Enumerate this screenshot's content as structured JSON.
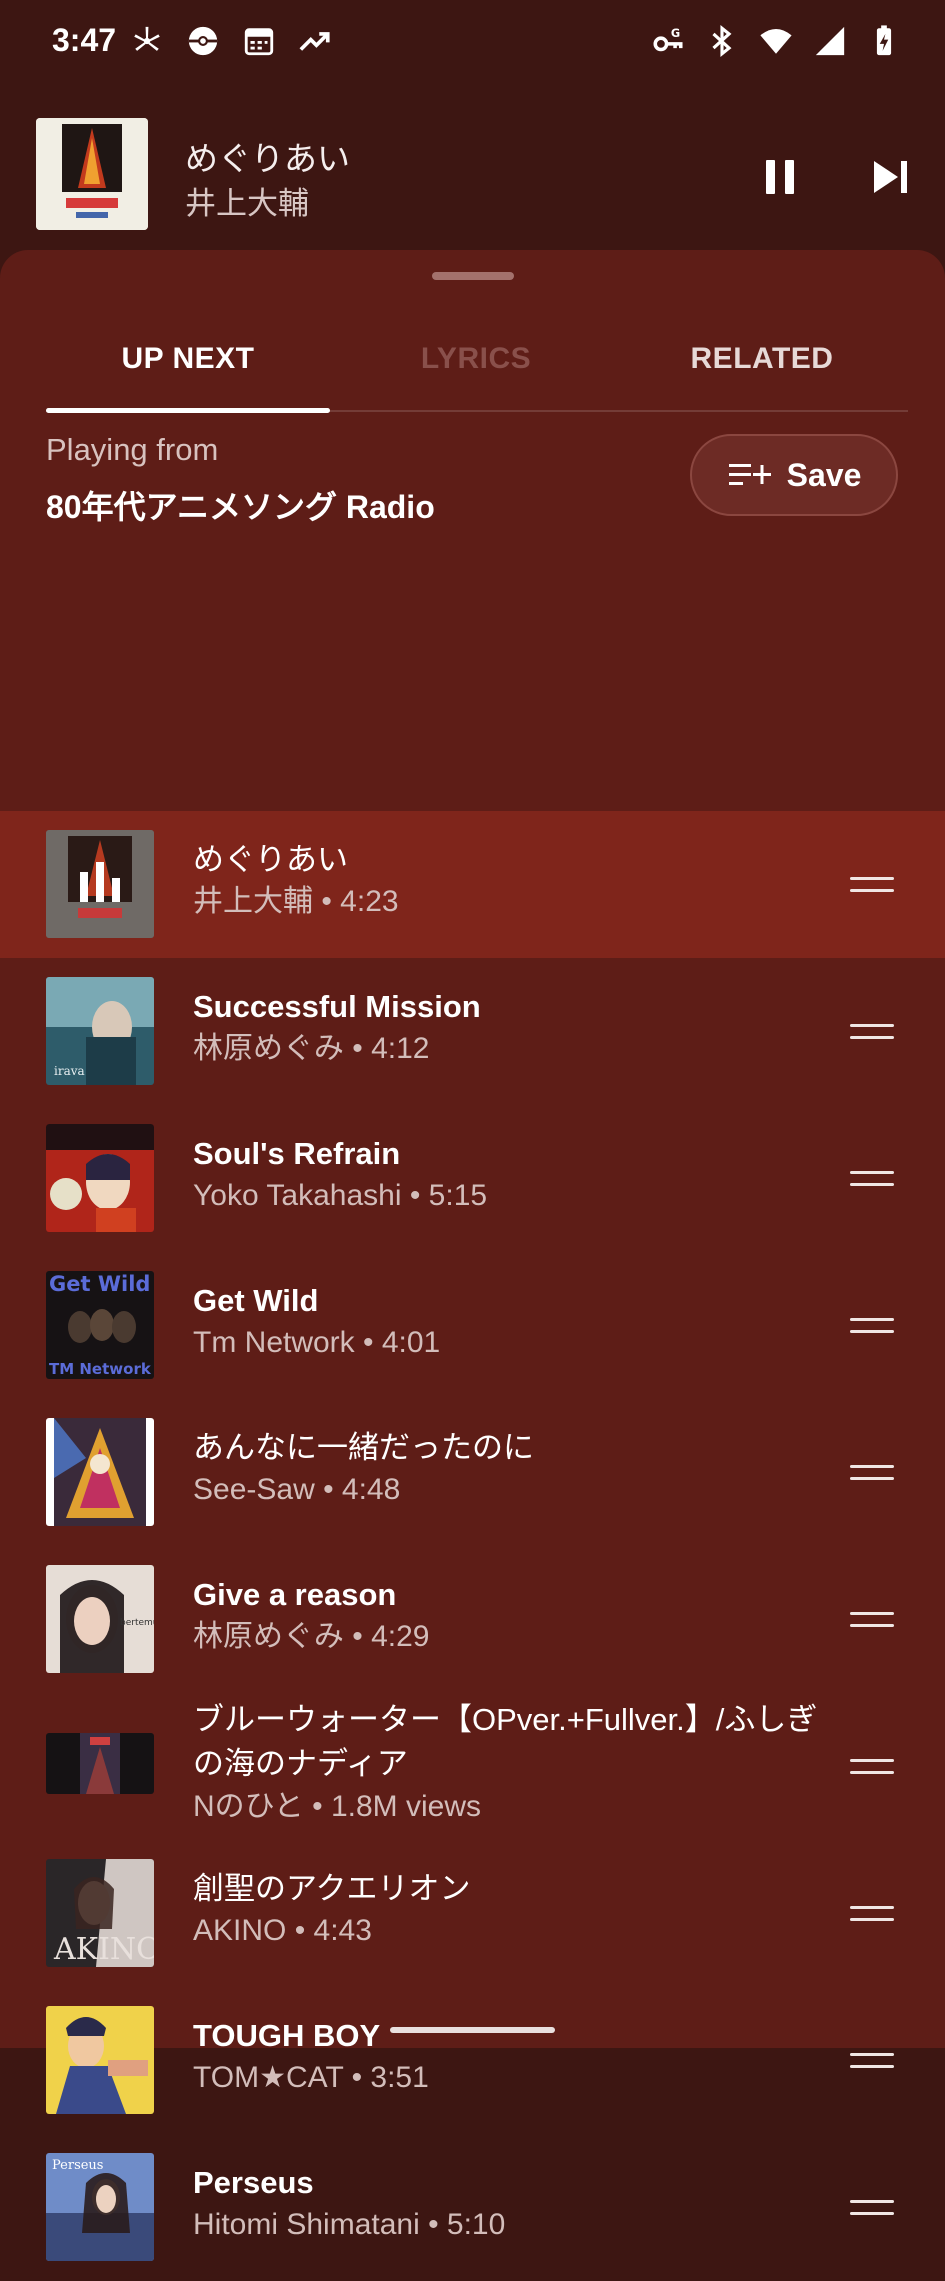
{
  "status": {
    "time": "3:47"
  },
  "mini_player": {
    "title": "めぐりあい",
    "artist": "井上大輔"
  },
  "tabs": [
    {
      "label": "UP NEXT"
    },
    {
      "label": "LYRICS"
    },
    {
      "label": "RELATED"
    }
  ],
  "playing_from": {
    "label": "Playing from",
    "value": "80年代アニメソング Radio"
  },
  "save": {
    "label": "Save"
  },
  "queue": [
    {
      "title": "めぐりあい",
      "subtitle": "井上大輔 • 4:23",
      "active": true
    },
    {
      "title": "Successful Mission",
      "subtitle": "林原めぐみ • 4:12"
    },
    {
      "title": "Soul's Refrain",
      "subtitle": "Yoko Takahashi • 5:15"
    },
    {
      "title": "Get Wild",
      "subtitle": "Tm Network • 4:01",
      "art_text_top": "Get Wild",
      "art_text_bottom": "TM Network"
    },
    {
      "title": "あんなに一緒だったのに",
      "subtitle": "See-Saw • 4:48"
    },
    {
      "title": "Give a reason",
      "subtitle": "林原めぐみ • 4:29"
    },
    {
      "title": "ブルーウォーター【OPver.+Fullver.】/ふしぎの海のナディア",
      "subtitle": "Nのひと • 1.8M views"
    },
    {
      "title": "創聖のアクエリオン",
      "subtitle": "AKINO • 4:43"
    },
    {
      "title": "TOUGH BOY",
      "subtitle": "TOM★CAT • 3:51"
    },
    {
      "title": "Perseus",
      "subtitle": "Hitomi Shimatani • 5:10"
    }
  ]
}
